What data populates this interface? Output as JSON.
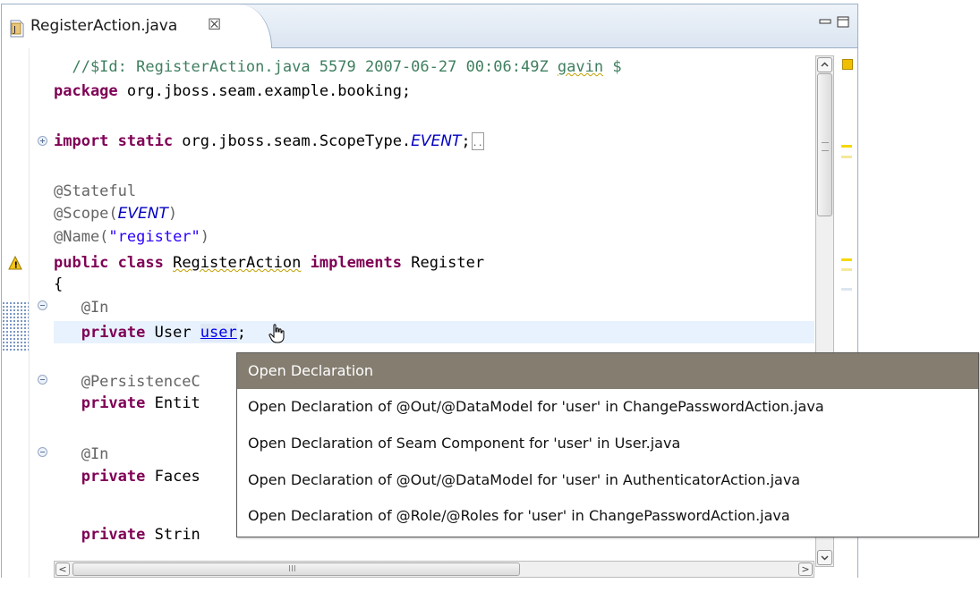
{
  "tab": {
    "title": "RegisterAction.java",
    "close_glyph": "☒",
    "icon": "java-file-icon"
  },
  "window": {
    "minimize": "minimize-icon",
    "maximize": "maximize-icon"
  },
  "code": {
    "l1_comment": "  //$Id: RegisterAction.java 5579 2007-06-27 00:06:49Z ",
    "l1_gavin": "gavin",
    "l1_end": " $",
    "l2_kw": "package",
    "l2_rest": " org.jboss.seam.example.booking;",
    "l3_kw": "import static",
    "l3_rest": " org.jboss.seam.ScopeType.",
    "l3_field": "EVENT",
    "l3_end": ";",
    "l4": "@Stateful",
    "l5_pre": "@Scope(",
    "l5_field": "EVENT",
    "l5_post": ")",
    "l6_pre": "@Name(",
    "l6_str": "\"register\"",
    "l6_post": ")",
    "l7_kw1": "public class",
    "l7_class": "RegisterAction",
    "l7_kw2": "implements",
    "l7_rest": " Register",
    "l8": "{",
    "l9": "   @In",
    "l10_kw": "private",
    "l10_rest": " User ",
    "l10_link": "user",
    "l10_end": ";",
    "l11": "   @PersistenceC",
    "l12_kw": "private",
    "l12_rest": " Entit",
    "l13": "   @In",
    "l14_kw": "private",
    "l14_rest": " Faces",
    "l15_kw": "private",
    "l15_rest": " Strin"
  },
  "popup": {
    "items": [
      "Open Declaration",
      "Open Declaration of @Out/@DataModel for 'user' in ChangePasswordAction.java",
      "Open Declaration of Seam Component for 'user' in User.java",
      "Open Declaration of @Out/@DataModel for 'user' in AuthenticatorAction.java",
      "Open Declaration of @Role/@Roles for 'user' in ChangePasswordAction.java"
    ],
    "selected_index": 0
  },
  "scrollbar": {
    "grip": "III"
  },
  "colors": {
    "keyword": "#7f0055",
    "comment": "#3f7f5f",
    "string": "#2a00ff",
    "field": "#0000c0",
    "popup_selected": "#847d70"
  }
}
